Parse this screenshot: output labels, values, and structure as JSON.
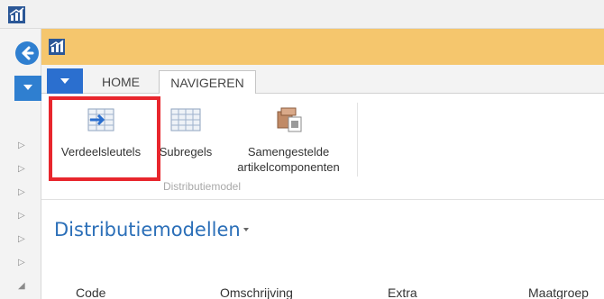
{
  "ribbon": {
    "tabs": [
      {
        "label": "HOME"
      },
      {
        "label": "NAVIGEREN"
      }
    ],
    "buttons": [
      {
        "label": "Verdeelsleutels",
        "icon": "grid-arrow-icon"
      },
      {
        "label": "Subregels",
        "icon": "grid-icon"
      },
      {
        "label_line1": "Samengestelde",
        "label_line2": "artikelcomponenten",
        "icon": "components-icon"
      }
    ],
    "group_label": "Distributiemodel"
  },
  "page": {
    "title": "Distributiemodellen"
  },
  "table": {
    "columns": [
      "Code",
      "Omschrijving",
      "Extra",
      "Maatgroep"
    ]
  },
  "colors": {
    "accent_blue": "#2b6fcf",
    "window_titlebar": "#f5c66d",
    "highlight_red": "#e8262d",
    "title_blue": "#2b6fb8"
  }
}
